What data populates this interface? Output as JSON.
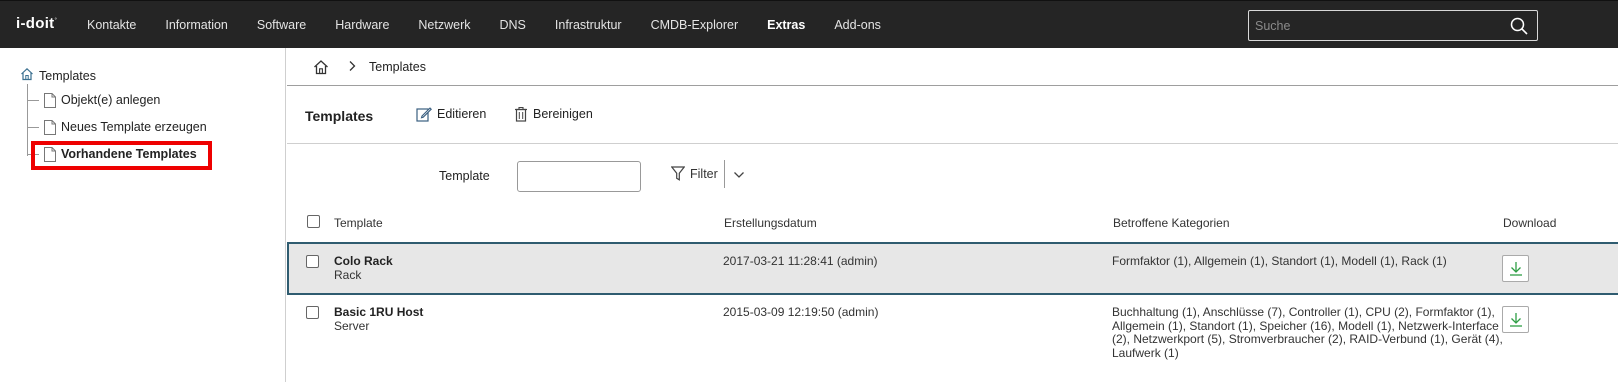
{
  "app": {
    "logo": "i-doit"
  },
  "nav": {
    "items": [
      {
        "label": "Kontakte",
        "active": false
      },
      {
        "label": "Information",
        "active": false
      },
      {
        "label": "Software",
        "active": false
      },
      {
        "label": "Hardware",
        "active": false
      },
      {
        "label": "Netzwerk",
        "active": false
      },
      {
        "label": "DNS",
        "active": false
      },
      {
        "label": "Infrastruktur",
        "active": false
      },
      {
        "label": "CMDB-Explorer",
        "active": false
      },
      {
        "label": "Extras",
        "active": true
      },
      {
        "label": "Add-ons",
        "active": false
      }
    ],
    "search_placeholder": "Suche",
    "search_value": ""
  },
  "sidebar": {
    "root": "Templates",
    "items": [
      {
        "label": "Objekt(e) anlegen"
      },
      {
        "label": "Neues Template erzeugen"
      },
      {
        "label": "Vorhandene Templates",
        "selected": true
      }
    ]
  },
  "breadcrumb": {
    "current": "Templates"
  },
  "toolbar": {
    "title": "Templates",
    "edit_label": "Editieren",
    "clean_label": "Bereinigen"
  },
  "filter": {
    "label": "Template",
    "value": "",
    "button_label": "Filter"
  },
  "table": {
    "columns": {
      "template": "Template",
      "created": "Erstellungsdatum",
      "categories": "Betroffene Kategorien",
      "download": "Download"
    },
    "rows": [
      {
        "name": "Colo Rack",
        "type": "Rack",
        "created": "2017-03-21 11:28:41 (admin)",
        "categories_lines": [
          "Formfaktor (1), Allgemein (1), Standort (1), Modell (1), Rack (1)"
        ],
        "selected": true
      },
      {
        "name": "Basic 1RU Host",
        "type": "Server",
        "created": "2015-03-09 12:19:50 (admin)",
        "categories_lines": [
          "Buchhaltung (1), Anschlüsse (7), Controller (1), CPU (2), Formfaktor (1),",
          "Allgemein (1), Standort (1), Speicher (16), Modell (1), Netzwerk-Interface",
          "(2), Netzwerkport (5), Stromverbraucher (2), RAID-Verbund (1), Gerät (4),",
          "Laufwerk (1)"
        ],
        "selected": false
      }
    ]
  },
  "colors": {
    "topbar": "#252525",
    "highlight": "#ee0000",
    "selected_row": "#e7e7e7",
    "download_icon": "#2e9e44"
  }
}
